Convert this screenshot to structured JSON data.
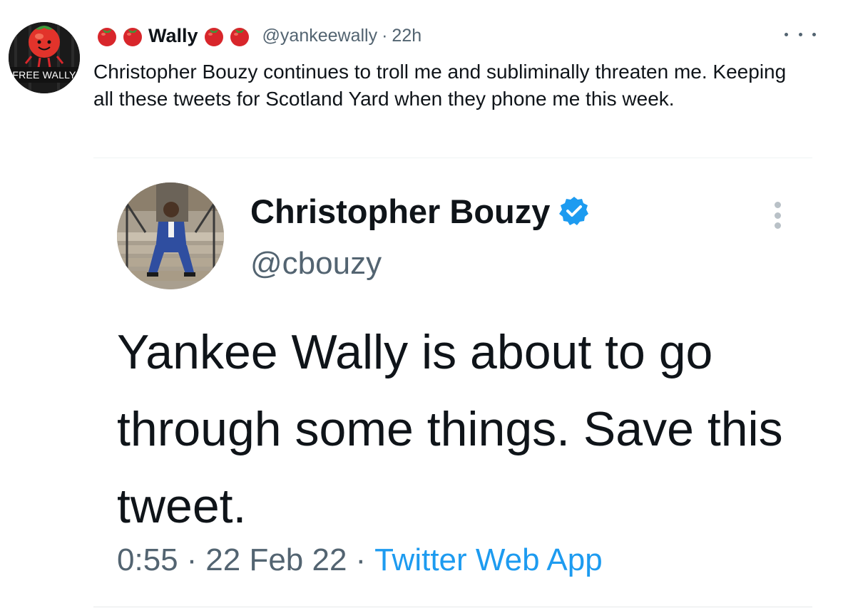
{
  "tweet": {
    "avatar_banner": "FREE WALLY",
    "display_name": "Wally",
    "name_emoji_count_before": 2,
    "name_emoji_count_after": 2,
    "handle": "@yankeewally",
    "separator": "·",
    "time": "22h",
    "text": "Christopher Bouzy continues to troll me and subliminally threaten me. Keeping all these tweets for Scotland Yard when they phone me this week."
  },
  "embedded_tweet": {
    "display_name": "Christopher Bouzy",
    "handle": "@cbouzy",
    "text": "Yankee Wally is about to go through some things. Save this tweet.",
    "time": "0:55",
    "separator": "·",
    "date": "22 Feb 22",
    "source": "Twitter Web App"
  },
  "icons": {
    "name_decoration": "tomato-emoji",
    "verified": "verified-badge-icon",
    "more": "more-options-icon"
  },
  "colors": {
    "text_primary": "#0f1419",
    "text_secondary": "#536471",
    "link": "#1d9bf0",
    "verified": "#1d9bf0",
    "tomato": "#d8262b"
  }
}
